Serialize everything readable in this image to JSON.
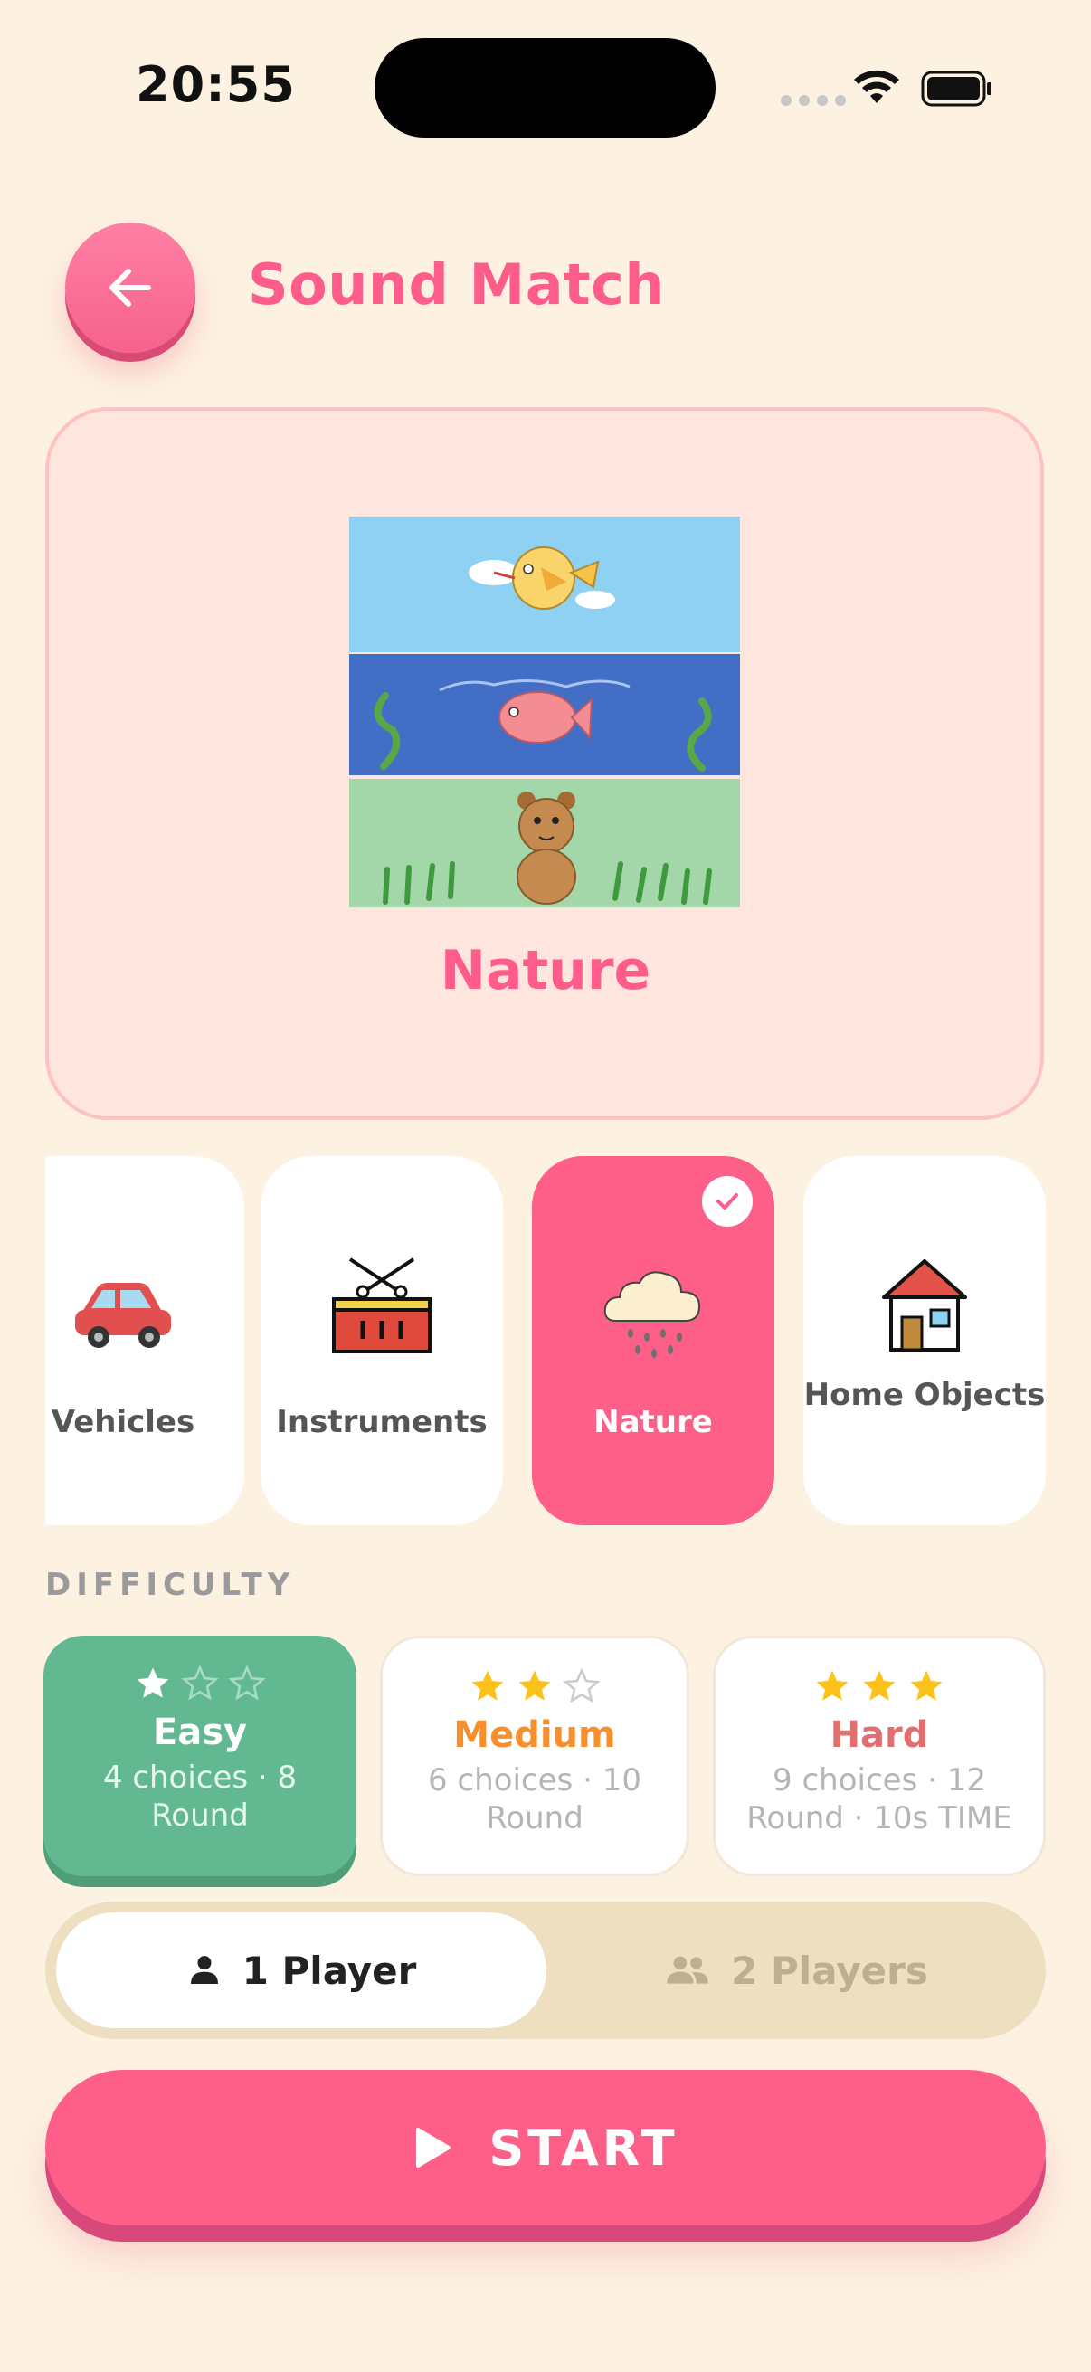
{
  "status_bar": {
    "time": "20:55"
  },
  "header": {
    "title": "Sound Match",
    "back_icon": "arrow-left-icon"
  },
  "preview": {
    "name": "Nature"
  },
  "categories": [
    {
      "label": "Vehicles",
      "icon": "car-icon",
      "selected": false
    },
    {
      "label": "Instruments",
      "icon": "drum-icon",
      "selected": false
    },
    {
      "label": "Nature",
      "icon": "rain-cloud-icon",
      "selected": true
    },
    {
      "label": "Home Objects",
      "icon": "house-icon",
      "selected": false
    }
  ],
  "difficulty": {
    "title": "DIFFICULTY",
    "options": [
      {
        "name": "Easy",
        "desc": "4 choices · 8 Round",
        "stars": 1,
        "color": "#ffffff",
        "selected": true
      },
      {
        "name": "Medium",
        "desc": "6 choices · 10 Round",
        "stars": 2,
        "color": "#f6902f",
        "selected": false
      },
      {
        "name": "Hard",
        "desc": "9 choices · 12 Round · 10s TIME",
        "stars": 3,
        "color": "#e26f6f",
        "selected": false
      }
    ]
  },
  "players": {
    "one": "1 Player",
    "two": "2 Players",
    "selected": "one"
  },
  "start_label": "START",
  "colors": {
    "accent": "#fe5f89",
    "easy": "#62b890",
    "background": "#fdf1e1"
  }
}
